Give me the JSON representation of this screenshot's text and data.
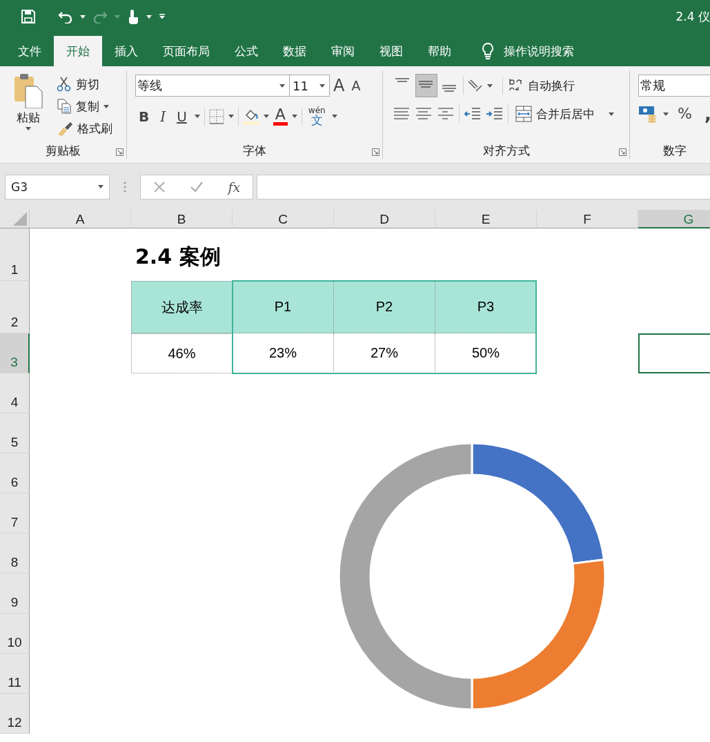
{
  "title_bar": {
    "title": "2.4 仪"
  },
  "tabs": [
    {
      "label": "文件",
      "selected": false
    },
    {
      "label": "开始",
      "selected": true
    },
    {
      "label": "插入",
      "selected": false
    },
    {
      "label": "页面布局",
      "selected": false
    },
    {
      "label": "公式",
      "selected": false
    },
    {
      "label": "数据",
      "selected": false
    },
    {
      "label": "审阅",
      "selected": false
    },
    {
      "label": "视图",
      "selected": false
    },
    {
      "label": "帮助",
      "selected": false
    }
  ],
  "tell_me": {
    "label": "操作说明搜索"
  },
  "ribbon": {
    "clipboard": {
      "title": "剪贴板",
      "paste": "粘贴",
      "cut": "剪切",
      "copy": "复制",
      "format_painter": "格式刷"
    },
    "font": {
      "title": "字体",
      "font_name": "等线",
      "font_size": "11",
      "grow": "A",
      "shrink": "A",
      "bold": "B",
      "italic": "I",
      "underline": "U",
      "font_color": "A",
      "phonetic": "wén",
      "phonetic_char": "文"
    },
    "alignment": {
      "title": "对齐方式",
      "vertical": [
        {
          "kind": "top",
          "selected": false
        },
        {
          "kind": "middle",
          "selected": true
        },
        {
          "kind": "bottom",
          "selected": false
        }
      ],
      "wrap_text": "自动换行",
      "merge_center": "合并后居中"
    },
    "number": {
      "title": "数字",
      "format": "常规",
      "percent": "%",
      "comma": ","
    }
  },
  "formula_bar": {
    "name_box": "G3",
    "function": "fx"
  },
  "sheet": {
    "columns": [
      {
        "label": "A",
        "selected": false
      },
      {
        "label": "B",
        "selected": false
      },
      {
        "label": "C",
        "selected": false
      },
      {
        "label": "D",
        "selected": false
      },
      {
        "label": "E",
        "selected": false
      },
      {
        "label": "F",
        "selected": false
      },
      {
        "label": "G",
        "selected": true
      }
    ],
    "rows": [
      {
        "label": "1",
        "selected": false
      },
      {
        "label": "2",
        "selected": false
      },
      {
        "label": "3",
        "selected": true
      },
      {
        "label": "4",
        "selected": false
      },
      {
        "label": "5",
        "selected": false
      },
      {
        "label": "6",
        "selected": false
      },
      {
        "label": "7",
        "selected": false
      },
      {
        "label": "8",
        "selected": false
      },
      {
        "label": "9",
        "selected": false
      },
      {
        "label": "10",
        "selected": false
      },
      {
        "label": "11",
        "selected": false
      },
      {
        "label": "12",
        "selected": false
      }
    ],
    "heading": "2.4 案例",
    "table": {
      "header": [
        "达成率",
        "P1",
        "P2",
        "P3"
      ],
      "values": [
        "46%",
        "23%",
        "27%",
        "50%"
      ]
    }
  }
}
